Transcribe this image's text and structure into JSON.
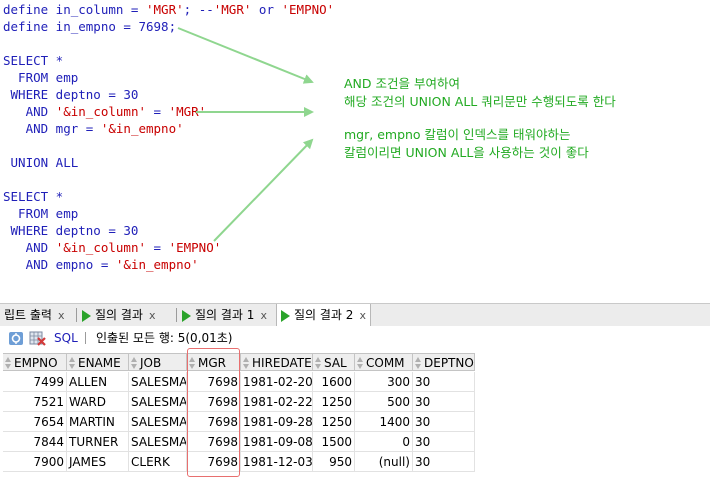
{
  "editor": {
    "lines": [
      {
        "parts": [
          {
            "t": "define in_column = ",
            "c": "k"
          },
          {
            "t": "'MGR'",
            "c": "s"
          },
          {
            "t": "; --",
            "c": "c"
          },
          {
            "t": "'MGR'",
            "c": "s"
          },
          {
            "t": " or ",
            "c": "c"
          },
          {
            "t": "'EMPNO'",
            "c": "s"
          }
        ]
      },
      {
        "parts": [
          {
            "t": "define in_empno = 7698;",
            "c": "k"
          }
        ]
      },
      {
        "parts": []
      },
      {
        "parts": [
          {
            "t": "SELECT *",
            "c": "k"
          }
        ]
      },
      {
        "parts": [
          {
            "t": "  FROM emp",
            "c": "k"
          }
        ]
      },
      {
        "parts": [
          {
            "t": " WHERE deptno = 30",
            "c": "k"
          }
        ]
      },
      {
        "parts": [
          {
            "t": "   AND ",
            "c": "k"
          },
          {
            "t": "'&in_column'",
            "c": "s"
          },
          {
            "t": " = ",
            "c": "k"
          },
          {
            "t": "'MGR'",
            "c": "s"
          }
        ]
      },
      {
        "parts": [
          {
            "t": "   AND mgr = ",
            "c": "k"
          },
          {
            "t": "'&in_empno'",
            "c": "s"
          }
        ]
      },
      {
        "parts": []
      },
      {
        "parts": [
          {
            "t": " UNION ALL",
            "c": "k"
          }
        ]
      },
      {
        "parts": []
      },
      {
        "parts": [
          {
            "t": "SELECT *",
            "c": "k"
          }
        ]
      },
      {
        "parts": [
          {
            "t": "  FROM emp",
            "c": "k"
          }
        ]
      },
      {
        "parts": [
          {
            "t": " WHERE deptno = 30",
            "c": "k"
          }
        ]
      },
      {
        "parts": [
          {
            "t": "   AND ",
            "c": "k"
          },
          {
            "t": "'&in_column'",
            "c": "s"
          },
          {
            "t": " = ",
            "c": "k"
          },
          {
            "t": "'EMPNO'",
            "c": "s"
          }
        ]
      },
      {
        "parts": [
          {
            "t": "   AND empno = ",
            "c": "k"
          },
          {
            "t": "'&in_empno'",
            "c": "s"
          }
        ]
      }
    ]
  },
  "notes": {
    "line1": "AND 조건을 부여하여",
    "line2": "해당 조건의 UNION ALL 쿼리문만 수행되도록 한다",
    "line3": "mgr, empno 칼럼이 인덱스를 태워야하는",
    "line4": "칼럼이리면 UNION ALL을 사용하는 것이 좋다"
  },
  "tabs": [
    {
      "label": "립트 출력",
      "close": "x"
    },
    {
      "label": "질의 결과",
      "close": "x"
    },
    {
      "label": "질의 결과 1",
      "close": "x"
    },
    {
      "label": "질의 결과 2",
      "close": "x"
    }
  ],
  "toolbar": {
    "sql_label": "SQL",
    "status": "인출된 모든 행: 5(0,01초)"
  },
  "grid": {
    "columns": [
      "EMPNO",
      "ENAME",
      "JOB",
      "MGR",
      "HIREDATE",
      "SAL",
      "COMM",
      "DEPTNO"
    ],
    "rows": [
      [
        "7499",
        "ALLEN",
        "SALESMAN",
        "7698",
        "1981-02-20",
        "1600",
        "300",
        "30"
      ],
      [
        "7521",
        "WARD",
        "SALESMAN",
        "7698",
        "1981-02-22",
        "1250",
        "500",
        "30"
      ],
      [
        "7654",
        "MARTIN",
        "SALESMAN",
        "7698",
        "1981-09-28",
        "1250",
        "1400",
        "30"
      ],
      [
        "7844",
        "TURNER",
        "SALESMAN",
        "7698",
        "1981-09-08",
        "1500",
        "0",
        "30"
      ],
      [
        "7900",
        "JAMES",
        "CLERK",
        "7698",
        "1981-12-03",
        "950",
        "(null)",
        "30"
      ]
    ]
  },
  "colors": {
    "keyword": "#1f1fb8",
    "string": "#c80000",
    "note": "#22aa22",
    "arrow": "#8fd68f",
    "highlight": "#e86f6f",
    "run_icon": "#2aa32a"
  }
}
